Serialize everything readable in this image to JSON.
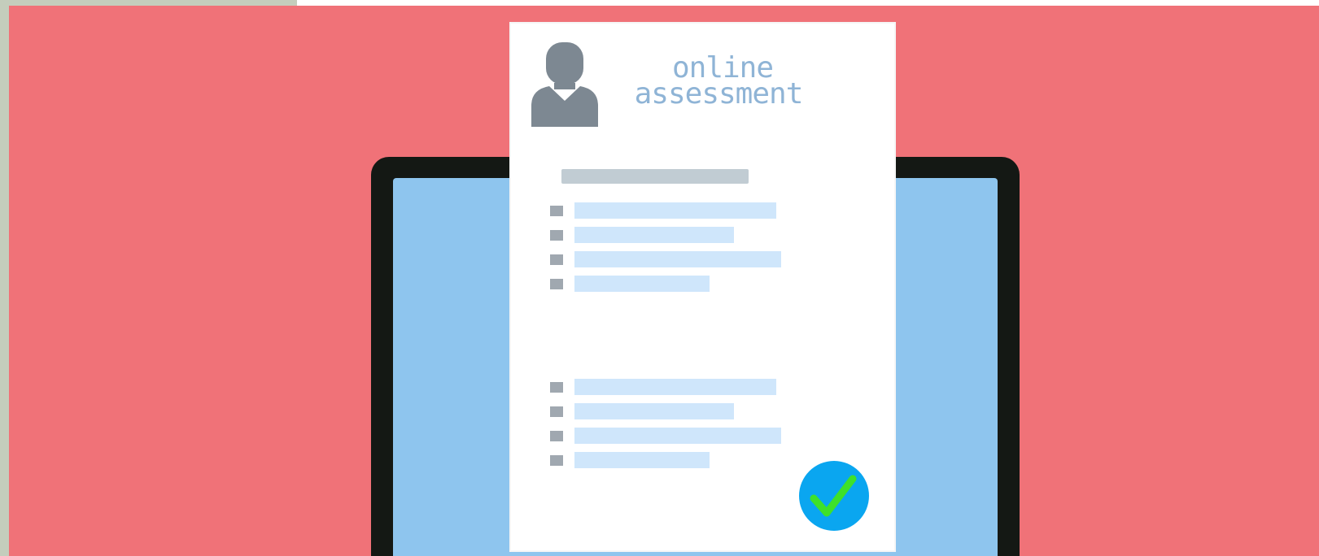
{
  "illustration": {
    "title_line1": "online",
    "title_line2": "assessment",
    "checklist_groups": [
      {
        "items": [
          {
            "length": "long"
          },
          {
            "length": "medium"
          },
          {
            "length": "longest"
          },
          {
            "length": "short"
          }
        ]
      },
      {
        "items": [
          {
            "length": "long"
          },
          {
            "length": "medium"
          },
          {
            "length": "longest"
          },
          {
            "length": "short"
          }
        ]
      }
    ],
    "colors": {
      "backdrop": "#f07278",
      "laptop_frame": "#141814",
      "laptop_screen": "#8ec5ee",
      "document": "#ffffff",
      "title_text": "#8fb4d6",
      "person_icon": "#7d8892",
      "heading_bar": "#c1ccd3",
      "line_bar": "#cfe6fb",
      "check_box": "#a0a8b0",
      "check_badge": "#0aa6f0",
      "check_mark": "#3ee12a",
      "margin_strip": "#c4cdbc"
    },
    "icons": {
      "person": "user-silhouette-icon",
      "check": "checkmark-circle-icon"
    }
  }
}
